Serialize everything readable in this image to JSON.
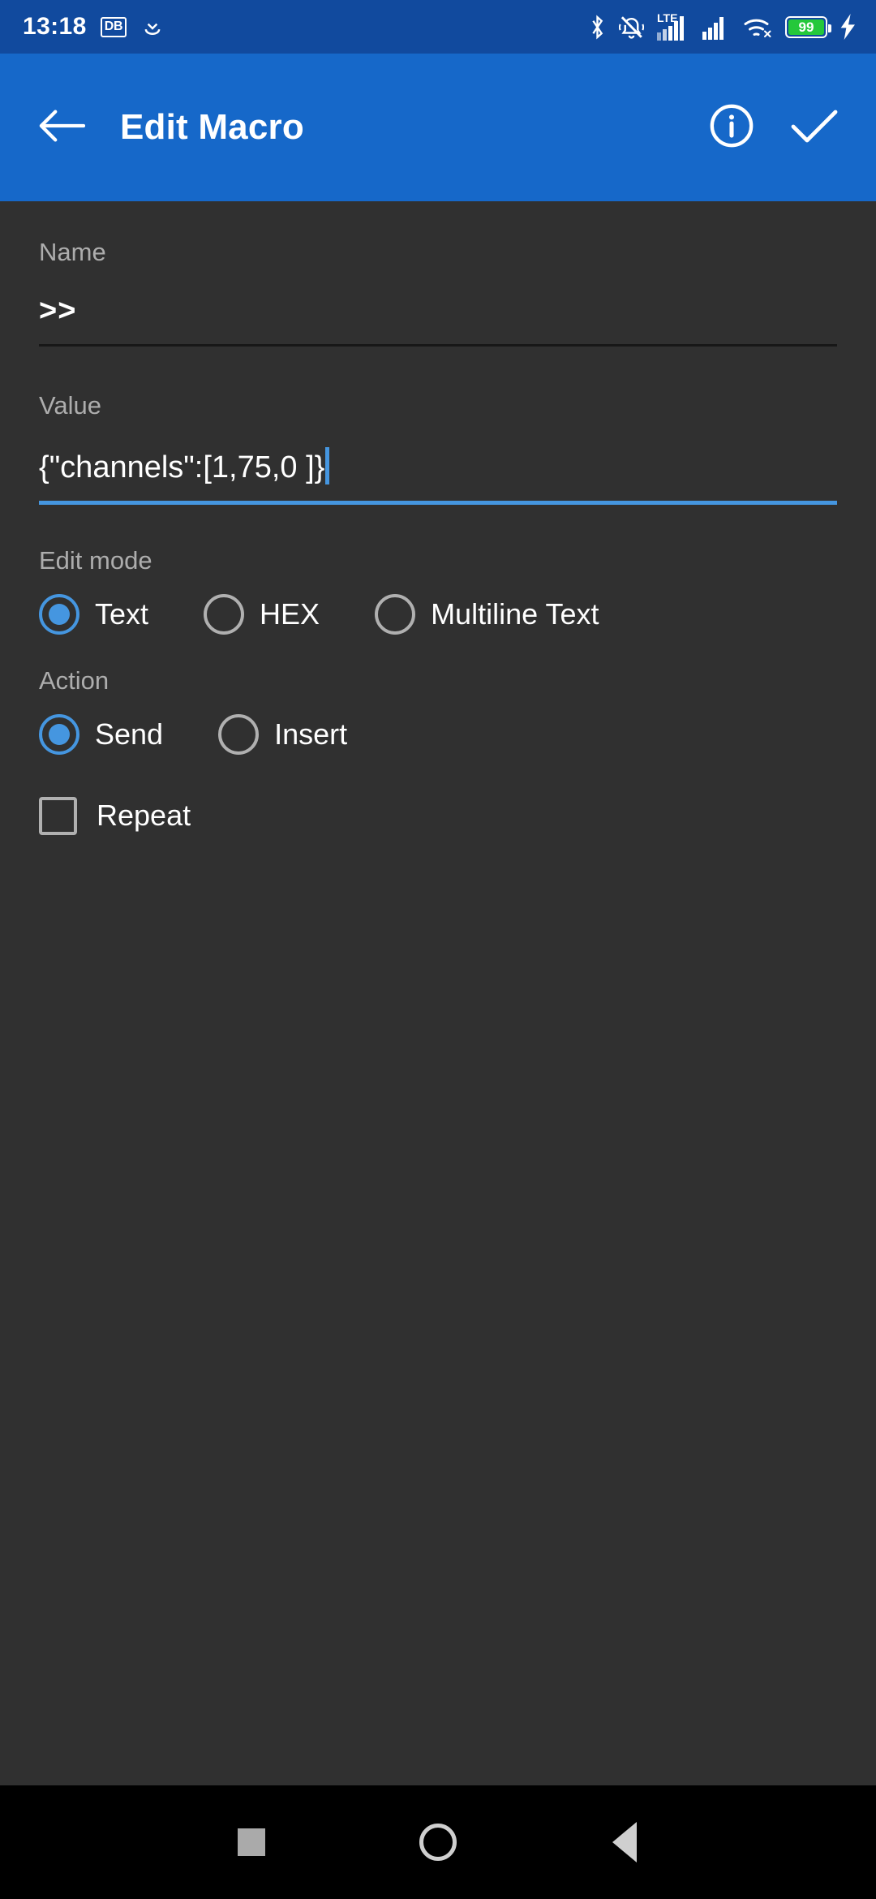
{
  "status_bar": {
    "time": "13:18",
    "icons_left": [
      "db-badge-icon",
      "download-icon"
    ],
    "db_badge_text": "DB",
    "icons_right": [
      "bluetooth-icon",
      "vibrate-off-icon",
      "lte-signal-icon",
      "signal-icon",
      "wifi-icon",
      "battery-icon",
      "charging-bolt-icon"
    ],
    "network_label": "LTE",
    "battery_percent": "99",
    "bg_color": "#114A9E"
  },
  "app_bar": {
    "back_icon": "back-arrow-icon",
    "title": "Edit Macro",
    "info_icon": "info-circle-icon",
    "confirm_icon": "check-icon",
    "bg_color": "#1668C9"
  },
  "form": {
    "name": {
      "label": "Name",
      "value": ">>",
      "placeholder": "Name",
      "focused": false
    },
    "value": {
      "label": "Value",
      "value": "{\"channels\":[1,75,0 ]}",
      "placeholder": "Value",
      "focused": true
    },
    "edit_mode": {
      "label": "Edit mode",
      "selected": "Text",
      "options": [
        {
          "label": "Text",
          "checked": true
        },
        {
          "label": "HEX",
          "checked": false
        },
        {
          "label": "Multiline Text",
          "checked": false
        }
      ]
    },
    "action": {
      "label": "Action",
      "selected": "Send",
      "options": [
        {
          "label": "Send",
          "checked": true
        },
        {
          "label": "Insert",
          "checked": false
        }
      ]
    },
    "repeat": {
      "label": "Repeat",
      "checked": false
    }
  },
  "nav_bar": {
    "recents_icon": "square-recents-icon",
    "home_icon": "circle-home-icon",
    "back_icon": "triangle-back-icon"
  },
  "colors": {
    "accent": "#4596E0",
    "app_bar": "#1668C9",
    "status_bar": "#114A9E",
    "background": "#303030",
    "label": "#ADADAD",
    "battery_green": "#25C83B"
  }
}
